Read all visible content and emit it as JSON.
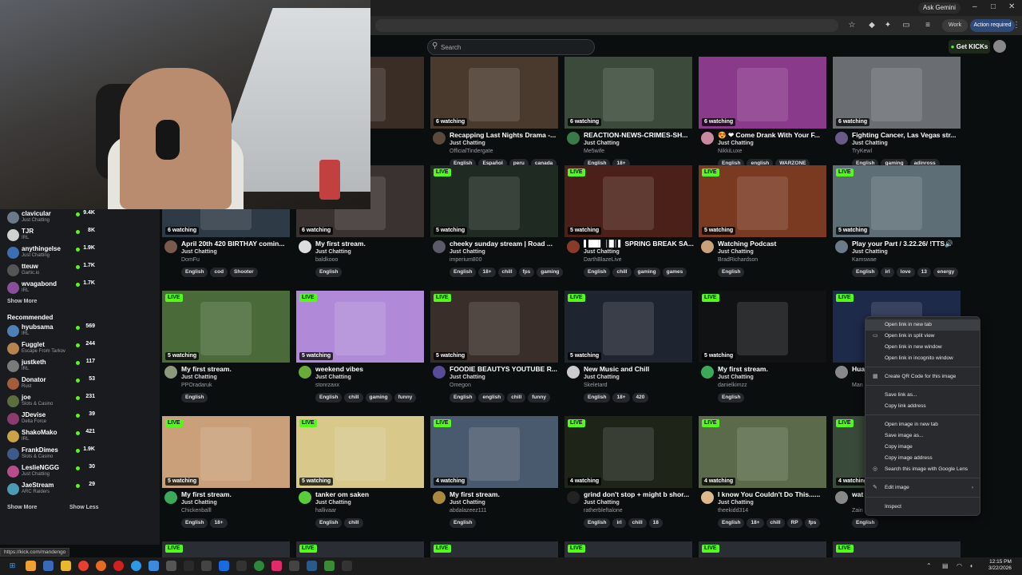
{
  "browser": {
    "ask_gemini": "Ask Gemini",
    "profile_label": "Work",
    "action_label": "Action required",
    "status_url": "https://kick.com/mandengo"
  },
  "kick": {
    "search_placeholder": "Search",
    "get_kicks": "Get KICKs"
  },
  "sidebar": {
    "following": [
      {
        "name": "clavicular",
        "sub": "Just Chatting",
        "count": "9.4K",
        "color": "#6b7a8a"
      },
      {
        "name": "TJR",
        "sub": "IRL",
        "count": "8K",
        "color": "#d0d0d0"
      },
      {
        "name": "anythingelse",
        "sub": "Just Chatting",
        "count": "1.9K",
        "color": "#3d6fb0"
      },
      {
        "name": "tteuw",
        "sub": "Gartic.io",
        "count": "1.7K",
        "color": "#555"
      },
      {
        "name": "wvagabond",
        "sub": "IRL",
        "count": "1.7K",
        "color": "#8a4f9a"
      }
    ],
    "show_more_1": "Show More",
    "recommended_title": "Recommended",
    "recommended": [
      {
        "name": "hyubsama",
        "sub": "IRL",
        "count": "569",
        "color": "#4e7fb5"
      },
      {
        "name": "Fugglet",
        "sub": "Escape From Tarkov",
        "count": "244",
        "color": "#b5834e"
      },
      {
        "name": "justketh",
        "sub": "IRL",
        "count": "117",
        "color": "#7a7a7a"
      },
      {
        "name": "Donator",
        "sub": "Rust",
        "count": "53",
        "color": "#a35c3c"
      },
      {
        "name": "joe",
        "sub": "Slots & Casino",
        "count": "231",
        "color": "#5c6e3c"
      },
      {
        "name": "JDevise",
        "sub": "Delta Force",
        "count": "39",
        "color": "#8a3c6e"
      },
      {
        "name": "ShakoMako",
        "sub": "IRL",
        "count": "421",
        "color": "#c9a24a"
      },
      {
        "name": "FrankDimes",
        "sub": "Slots & Casino",
        "count": "1.9K",
        "color": "#3c5a8a"
      },
      {
        "name": "LeslieNGGG",
        "sub": "Just Chatting",
        "count": "30",
        "color": "#b54e8a"
      },
      {
        "name": "JaeStream",
        "sub": "ARC Raiders",
        "count": "29",
        "color": "#4e9ab5"
      }
    ],
    "show_more_2": "Show More",
    "show_less": "Show Less"
  },
  "live_label": "LIVE",
  "rows": [
    [
      {
        "watching": "6 watching",
        "title": "",
        "category": "",
        "user": "",
        "tags": [
          "atting",
          "spanish"
        ],
        "av": "#777",
        "bg": "#3a2d25"
      },
      {
        "watching": "6 watching",
        "title": "Recapping Last Nights Drama -...",
        "category": "Just Chatting",
        "user": "OfficialTindergate",
        "tags": [
          "English",
          "Español",
          "peru",
          "canada"
        ],
        "av": "#5a4a3a",
        "bg": "#4a3a2e"
      },
      {
        "watching": "6 watching",
        "title": "REACTION-NEWS-CRIMES-SH...",
        "category": "Just Chatting",
        "user": "Me5wife",
        "tags": [
          "English",
          "18+"
        ],
        "av": "#3a7a4a",
        "bg": "#3b4a3a"
      },
      {
        "watching": "6 watching",
        "title": "😍 ❤ Come Drank With Your F...",
        "category": "Just Chatting",
        "user": "NikkiLuxe",
        "tags": [
          "English",
          "english",
          "WARZONE"
        ],
        "av": "#c98aa0",
        "bg": "#8a3a8a"
      },
      {
        "watching": "6 watching",
        "title": "Fighting Cancer, Las Vegas str...",
        "category": "Just Chatting",
        "user": "TryKewl",
        "tags": [
          "English",
          "gaming",
          "adinross"
        ],
        "av": "#6a5a8a",
        "bg": "#6a6e72"
      }
    ],
    [
      {
        "watching": "6 watching",
        "title": "April 20th 420 BIRTHAY comin...",
        "category": "Just Chatting",
        "user": "DomFu",
        "tags": [
          "English",
          "cod",
          "Shooter"
        ],
        "av": "#7a5a4a",
        "bg": "#2e3a46"
      },
      {
        "watching": "6 watching",
        "title": "My first stream.",
        "category": "Just Chatting",
        "user": "baldkooo",
        "tags": [
          "English"
        ],
        "av": "#ddd",
        "bg": "#3a3230"
      },
      {
        "watching": "5 watching",
        "title": "cheeky sunday stream | Road ...",
        "category": "Just Chatting",
        "user": "imperium800",
        "tags": [
          "English",
          "18+",
          "chill",
          "fps",
          "gaming"
        ],
        "av": "#5a5a6a",
        "bg": "#1e2a22"
      },
      {
        "watching": "5 watching",
        "title": "▌██▌ │█│▌ SPRING BREAK SA...",
        "category": "Just Chatting",
        "user": "DarthBlazeLive",
        "tags": [
          "English",
          "chill",
          "gaming",
          "games"
        ],
        "av": "#8a3a2a",
        "bg": "#4a2018"
      },
      {
        "watching": "5 watching",
        "title": "Watching Podcast",
        "category": "Just Chatting",
        "user": "BradRichardson",
        "tags": [
          "English"
        ],
        "av": "#c9a27a",
        "bg": "#7a3a22"
      },
      {
        "watching": "5 watching",
        "title": "Play your Part / 3.22.26/ !TTS🔊",
        "category": "Just Chatting",
        "user": "Kamswae",
        "tags": [
          "English",
          "irl",
          "love",
          "13",
          "energy"
        ],
        "av": "#6a7a8a",
        "bg": "#5e6e76"
      }
    ],
    [
      {
        "watching": "5 watching",
        "title": "My first stream.",
        "category": "Just Chatting",
        "user": "PPOradaruk",
        "tags": [
          "English"
        ],
        "av": "#8a9a7a",
        "bg": "#4a6a3a"
      },
      {
        "watching": "5 watching",
        "title": "weekend vibes",
        "category": "Just Chatting",
        "user": "stonrzaxx",
        "tags": [
          "English",
          "chill",
          "gaming",
          "funny"
        ],
        "av": "#6aaa3a",
        "bg": "#b08ad8"
      },
      {
        "watching": "5 watching",
        "title": "FOODIE BEAUTYS YOUTUBE R...",
        "category": "Just Chatting",
        "user": "Omegon",
        "tags": [
          "English",
          "english",
          "chill",
          "funny"
        ],
        "av": "#5a4a9a",
        "bg": "#3a2e2a"
      },
      {
        "watching": "5 watching",
        "title": "New Music and Chill",
        "category": "Just Chatting",
        "user": "Skeletard",
        "tags": [
          "English",
          "18+",
          "420"
        ],
        "av": "#ccc",
        "bg": "#1e2430"
      },
      {
        "watching": "5 watching",
        "title": "My first stream.",
        "category": "Just Chatting",
        "user": "danielkimzz",
        "tags": [
          "English"
        ],
        "av": "#3aaa5a",
        "bg": "#101214"
      },
      {
        "watching": "",
        "title": "Hua",
        "category": "",
        "user": "Man",
        "tags": [],
        "av": "#888",
        "bg": "#1e2a4a"
      }
    ],
    [
      {
        "watching": "5 watching",
        "title": "My first stream.",
        "category": "Just Chatting",
        "user": "Chickenballl",
        "tags": [
          "English",
          "18+"
        ],
        "av": "#3aaa5a",
        "bg": "#c9a07a"
      },
      {
        "watching": "5 watching",
        "title": "tanker om saken",
        "category": "Just Chatting",
        "user": "hallivaar",
        "tags": [
          "English",
          "chill"
        ],
        "av": "#5acc3a",
        "bg": "#d8c88a"
      },
      {
        "watching": "4 watching",
        "title": "My first stream.",
        "category": "Just Chatting",
        "user": "abdalazeez111",
        "tags": [
          "English"
        ],
        "av": "#aa8a3a",
        "bg": "#4a5a6e"
      },
      {
        "watching": "4 watching",
        "title": "grind don't stop + might b shor...",
        "category": "Just Chatting",
        "user": "ratherbleftalone",
        "tags": [
          "English",
          "irl",
          "chill",
          "18"
        ],
        "av": "#222",
        "bg": "#1e2418"
      },
      {
        "watching": "4 watching",
        "title": "I know You Couldn't Do This......",
        "category": "Just Chatting",
        "user": "theekidd314",
        "tags": [
          "English",
          "18+",
          "chill",
          "RP",
          "fps"
        ],
        "av": "#e0b88a",
        "bg": "#5a6a4a"
      },
      {
        "watching": "4 watching",
        "title": "wat",
        "category": "",
        "user": "Zain",
        "tags": [
          "English"
        ],
        "av": "#888",
        "bg": "#3a4a3a"
      }
    ]
  ],
  "context_menu": [
    {
      "label": "Open link in new tab",
      "icon": "none"
    },
    {
      "label": "Open link in split view",
      "icon": "split-view-icon"
    },
    {
      "label": "Open link in new window",
      "icon": "none"
    },
    {
      "label": "Open link in incognito window",
      "icon": "none"
    },
    {
      "label": "Create QR Code for this image",
      "icon": "qr-code-icon"
    },
    {
      "label": "Save link as...",
      "icon": "none"
    },
    {
      "label": "Copy link address",
      "icon": "none"
    },
    {
      "label": "Open image in new tab",
      "icon": "none"
    },
    {
      "label": "Save image as...",
      "icon": "none"
    },
    {
      "label": "Copy image",
      "icon": "none"
    },
    {
      "label": "Copy image address",
      "icon": "none"
    },
    {
      "label": "Search this image with Google Lens",
      "icon": "google-lens-icon"
    },
    {
      "label": "Edit image",
      "icon": "edit-image-icon"
    },
    {
      "label": "Inspect",
      "icon": "none"
    }
  ],
  "taskbar": {
    "time": "12:15 PM",
    "date": "3/22/2026"
  },
  "colors": {
    "kick_green": "#53fc18",
    "background": "#0b0e0f",
    "sidebar": "#191b1f"
  }
}
